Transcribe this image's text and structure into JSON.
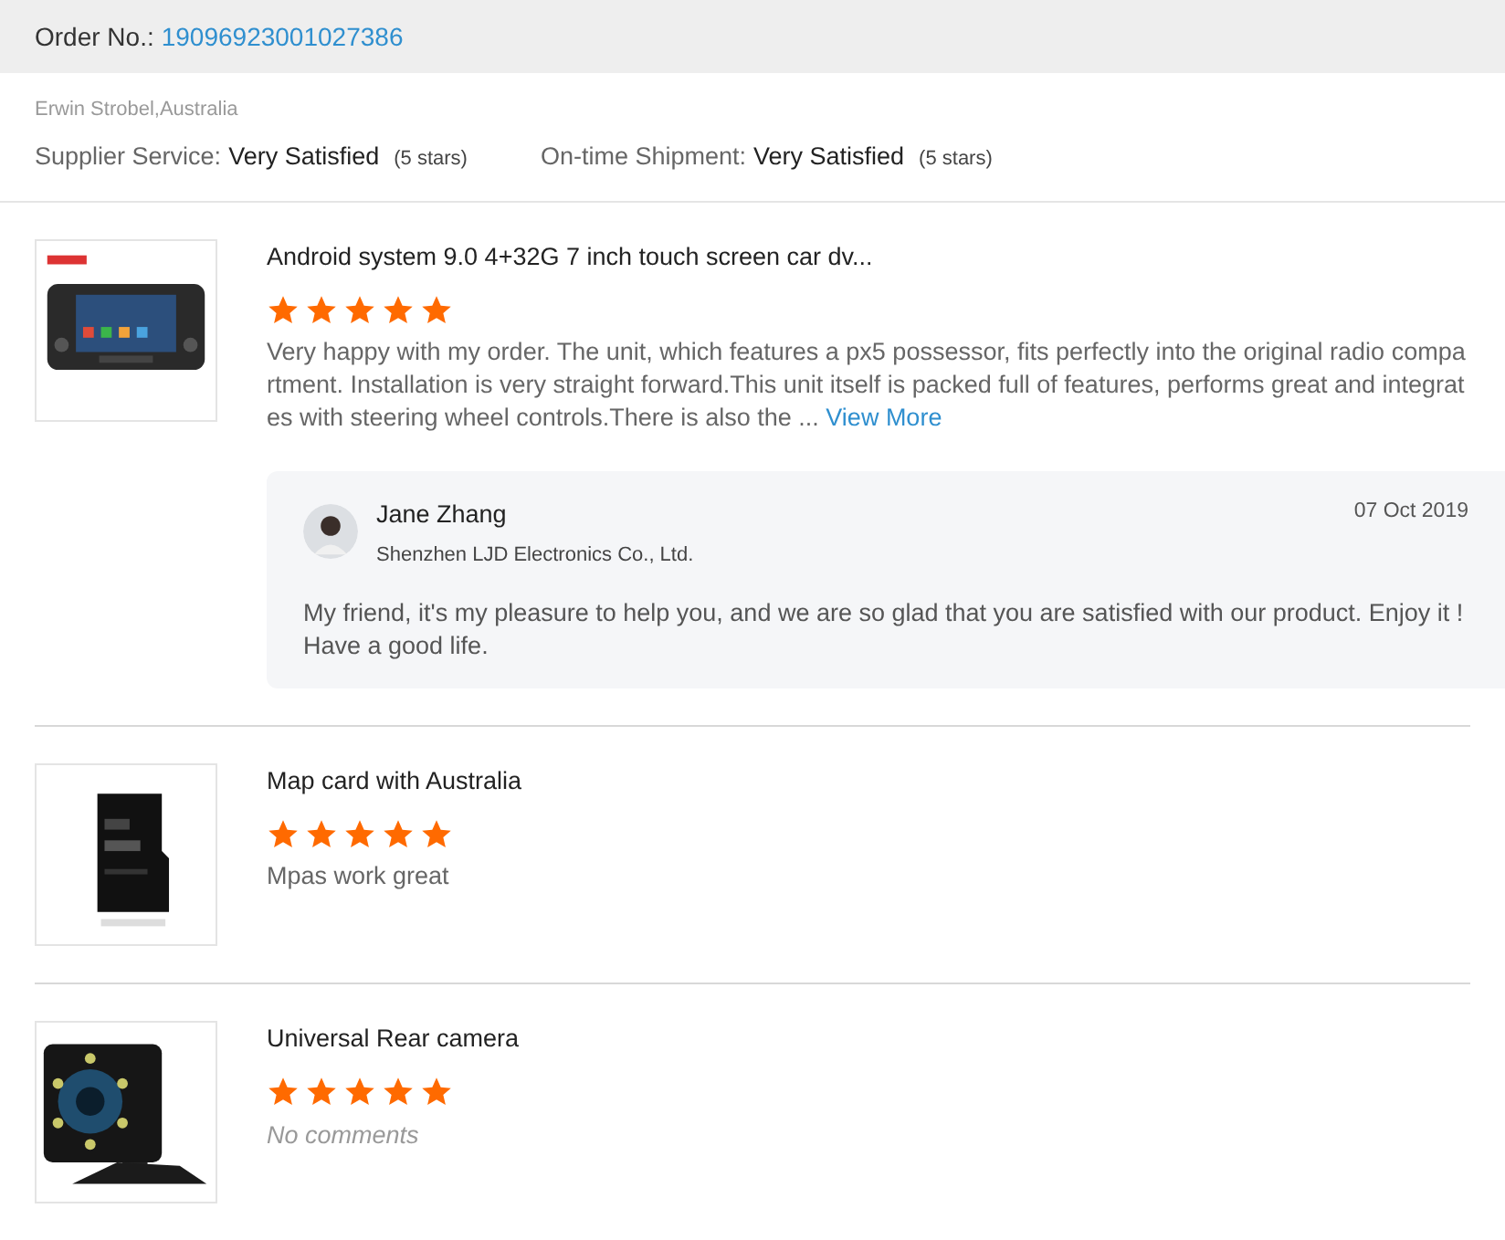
{
  "order": {
    "label": "Order No.:",
    "number": "19096923001027386"
  },
  "buyer": {
    "name": "Erwin Strobel,Australia",
    "ratings": [
      {
        "label": "Supplier Service:",
        "value": "Very Satisfied",
        "stars_text": "(5 stars)"
      },
      {
        "label": "On-time Shipment:",
        "value": "Very Satisfied",
        "stars_text": "(5 stars)"
      }
    ]
  },
  "products": [
    {
      "kind": "stereo",
      "title": "Android system 9.0 4+32G 7 inch touch screen car dv...",
      "stars": 5,
      "comment": {
        "kind": "text",
        "text": "Very happy with my order. The unit, which features a px5 possessor, fits perfectly into the original radio compartment. Installation is very straight forward.This unit itself is packed full of features, performs great and integrates with steering wheel controls.There is also the ...",
        "link": "View More"
      },
      "reply": {
        "name": "Jane Zhang",
        "company": "Shenzhen LJD Electronics Co., Ltd.",
        "date": "07 Oct 2019",
        "text": "My friend, it's my pleasure to help you, and we are so glad that you are satisfied with our product. Enjoy it ! Have a good life."
      }
    },
    {
      "kind": "card",
      "title": "Map card with Australia",
      "stars": 5,
      "comment": {
        "kind": "text",
        "text": "Mpas work great"
      }
    },
    {
      "kind": "camera",
      "title": "Universal Rear camera",
      "stars": 5,
      "comment": {
        "kind": "none",
        "text": "No comments"
      }
    }
  ]
}
